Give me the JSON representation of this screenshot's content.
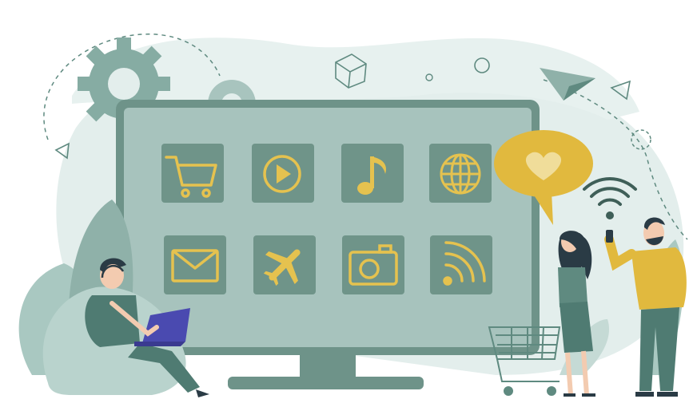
{
  "illustration": {
    "subject": "smart-tv-app-grid",
    "colors": {
      "teal_dark": "#5f8a80",
      "teal_mid": "#8fb1a9",
      "screen": "#a7c3bd",
      "screen_bezel": "#6e9389",
      "tile": "#6f9489",
      "tile_icon": "#e5c24f",
      "blob": "#dbe9e6",
      "mustard": "#e1b93e",
      "skin": "#f3cbb0",
      "hair": "#2a3b45",
      "laptop": "#4a4ab0"
    },
    "app_tiles": [
      {
        "icon": "shopping-cart-icon"
      },
      {
        "icon": "play-icon"
      },
      {
        "icon": "music-note-icon"
      },
      {
        "icon": "globe-icon"
      },
      {
        "icon": "mail-icon"
      },
      {
        "icon": "airplane-icon"
      },
      {
        "icon": "camera-icon"
      },
      {
        "icon": "rss-icon"
      }
    ],
    "floating": [
      "gear-icon",
      "cube-icon",
      "paper-plane-icon",
      "heart-speech-bubble-icon",
      "wifi-icon",
      "triangle-icon",
      "circle-icon"
    ]
  }
}
